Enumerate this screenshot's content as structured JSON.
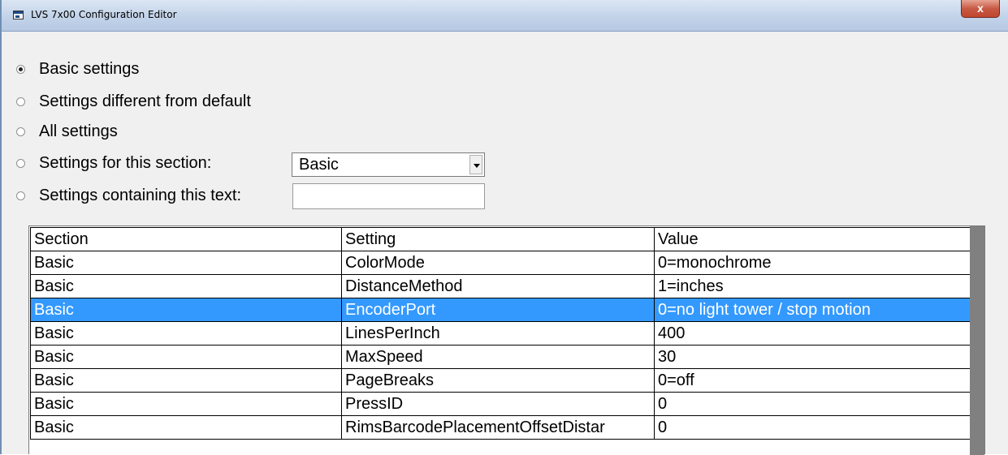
{
  "window": {
    "title": "LVS 7x00 Configuration Editor",
    "close_label": "x"
  },
  "filters": [
    {
      "label": "Basic settings",
      "checked": true
    },
    {
      "label": "Settings different from default",
      "checked": false
    },
    {
      "label": "All settings",
      "checked": false
    },
    {
      "label": "Settings for this section:",
      "checked": false
    },
    {
      "label": "Settings containing this text:",
      "checked": false
    }
  ],
  "section_select": {
    "value": "Basic"
  },
  "text_filter": {
    "value": ""
  },
  "grid": {
    "columns": [
      "Section",
      "Setting",
      "Value"
    ],
    "rows": [
      {
        "section": "Basic",
        "setting": "ColorMode",
        "value": "0=monochrome"
      },
      {
        "section": "Basic",
        "setting": "DistanceMethod",
        "value": "1=inches"
      },
      {
        "section": "Basic",
        "setting": "EncoderPort",
        "value": "0=no light tower / stop motion",
        "selected": true
      },
      {
        "section": "Basic",
        "setting": "LinesPerInch",
        "value": "400"
      },
      {
        "section": "Basic",
        "setting": "MaxSpeed",
        "value": "30"
      },
      {
        "section": "Basic",
        "setting": "PageBreaks",
        "value": "0=off"
      },
      {
        "section": "Basic",
        "setting": "PressID",
        "value": "0"
      },
      {
        "section": "Basic",
        "setting": "RimsBarcodePlacementOffsetDistar",
        "value": "0"
      }
    ]
  },
  "colors": {
    "selection": "#3399ff",
    "titlebar": "#c2d3e9",
    "close": "#c75a45"
  }
}
